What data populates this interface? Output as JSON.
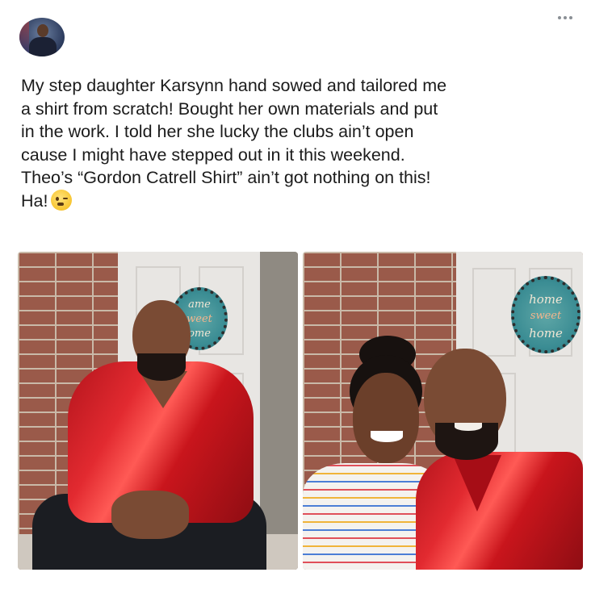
{
  "tweet": {
    "more_icon": "more-horizontal-icon",
    "text_lines": [
      "My step daughter Karsynn hand sowed and tailored me",
      "a shirt from scratch! Bought her own materials and put",
      "in the work. I told her she lucky the clubs ain’t open",
      "cause I might have stepped out in it this weekend.",
      "Theo’s “Gordon Catrell Shirt” ain’t got nothing on this!",
      "Ha!"
    ],
    "emoji": "winking-face-emoji",
    "photos": [
      {
        "description_icon": "photo-man-seated",
        "sign_text": [
          "ame",
          "weet",
          "ome"
        ]
      },
      {
        "description_icon": "photo-selfie",
        "sign_text": [
          "home",
          "sweet",
          "home"
        ]
      }
    ]
  }
}
